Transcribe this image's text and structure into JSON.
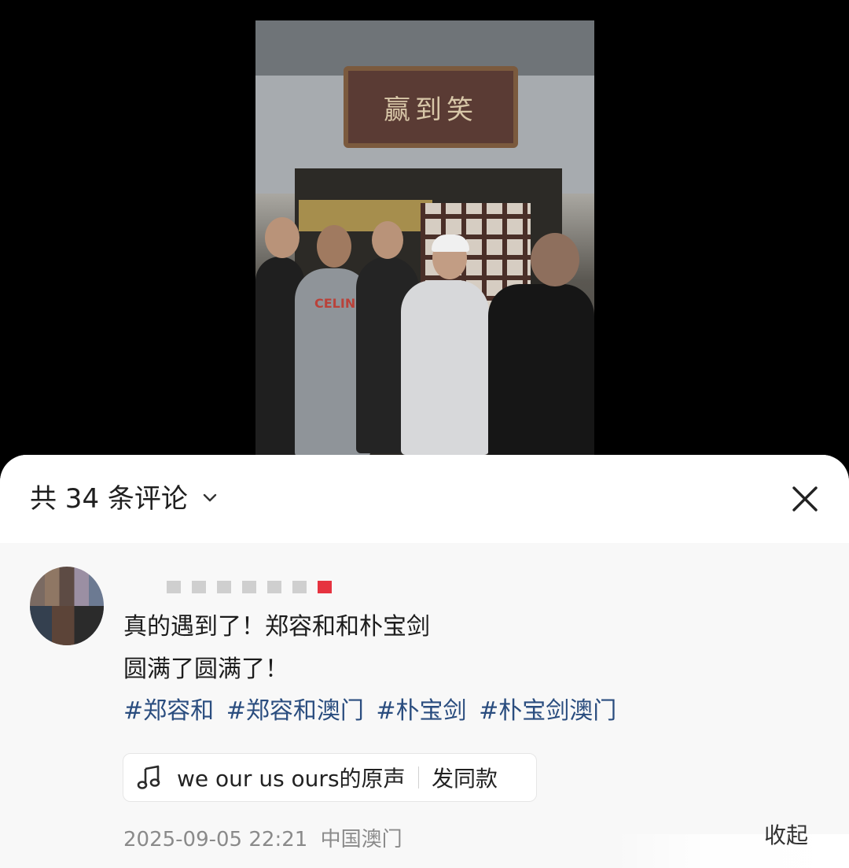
{
  "photo": {
    "sign_text": "赢到笑",
    "shirt_text": "CELINE"
  },
  "comments_header": {
    "title": "共 34 条评论"
  },
  "comment": {
    "line1": "真的遇到了！郑容和和朴宝剑",
    "line2": "圆满了圆满了！",
    "tags": [
      "#郑容和",
      "#郑容和澳门",
      "#朴宝剑",
      "#朴宝剑澳门"
    ],
    "music": {
      "song": "we our us ours的原声",
      "action": "发同款"
    },
    "timestamp": "2025-09-05 22:21",
    "location": "中国澳门",
    "collapse_label": "收起"
  },
  "colors": {
    "hashtag": "#2a4d7f",
    "accent_red": "#e63340"
  },
  "icons": [
    "chevron-down-icon",
    "close-icon",
    "music-note-icon"
  ]
}
